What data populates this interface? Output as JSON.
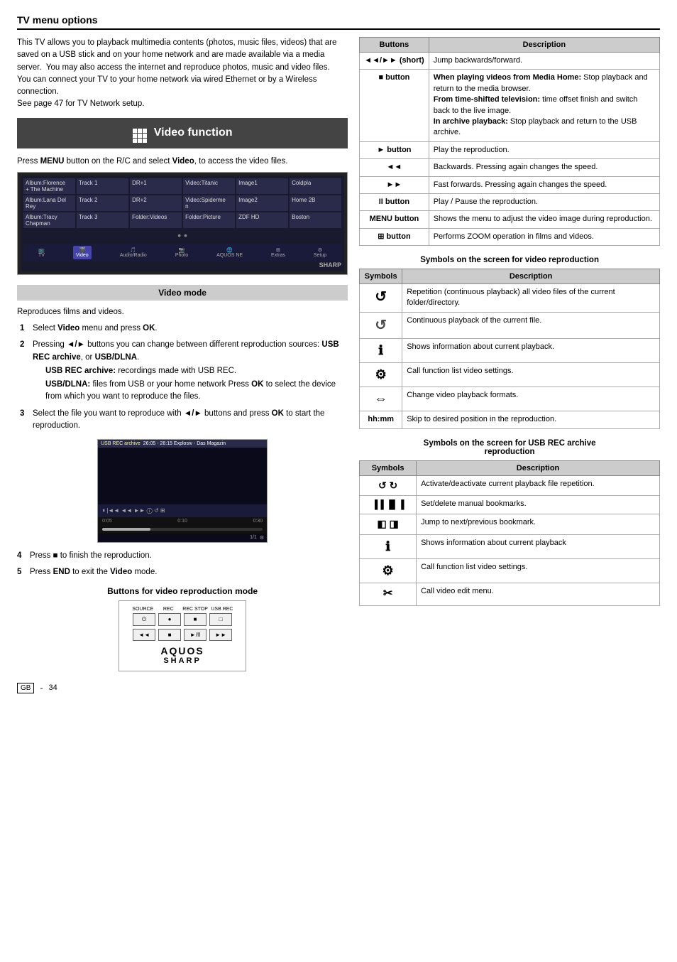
{
  "page": {
    "title": "TV menu options",
    "page_number": "34",
    "gb_label": "GB"
  },
  "intro": {
    "text": "This TV allows you to playback multimedia contents (photos, music files, videos) that are saved on a USB stick and on your home network and are made available via a media server.  You may also access the internet and reproduce photos, music and video files.\nYou can connect your TV to your home network via wired Ethernet or by a Wireless connection.\nSee page 47 for TV Network setup."
  },
  "video_function": {
    "header": "Video function",
    "press_text": "Press MENU button on the R/C and select Video, to access the video files."
  },
  "screenshot_rows": [
    [
      "Album:Florence + The Machine",
      "Track 1",
      "DR+1",
      "Video:Titanic",
      "Image1",
      "Coldpla"
    ],
    [
      "Album:Lana Del Rey",
      "Track 2",
      "DR+2",
      "Video:Spiderme",
      "Image2",
      "Home 2B"
    ],
    [
      "Album:Tracy Chapman",
      "Track 3",
      "Folder:Videos",
      "Folder:Picture",
      "ZDF HD",
      "Boston"
    ]
  ],
  "screenshot_nav": [
    {
      "label": "TV",
      "active": false
    },
    {
      "label": "Video",
      "active": true
    },
    {
      "label": "Audio/Radio",
      "active": false
    },
    {
      "label": "Photo",
      "active": false
    },
    {
      "label": "AQUOS NE",
      "active": false
    },
    {
      "label": "Extras",
      "active": false
    },
    {
      "label": "Setup",
      "active": false
    }
  ],
  "video_mode": {
    "header": "Video mode",
    "text": "Reproduces films and videos.",
    "steps": [
      {
        "num": "1",
        "text": "Select Video menu and press OK."
      },
      {
        "num": "2",
        "text": "Pressing ◄/► buttons you can change between different reproduction sources: USB REC archive, or USB/DLNA.",
        "subtext_1_label": "USB REC archive:",
        "subtext_1": " recordings made with USB REC.",
        "subtext_2_label": "USB/DLNA:",
        "subtext_2": " files from USB or your home network Press OK to select the device from which you want to reproduce the files."
      },
      {
        "num": "3",
        "text": "Select the file you want to reproduce with ◄/► buttons and press OK to start the reproduction."
      }
    ]
  },
  "playback_screenshot": {
    "top_bar": "USB REC archive",
    "time_bar": "26:05 - 26:15  Explosiv - Das Magazin",
    "time_start": "0:05",
    "time_mid": "0:10",
    "time_end": "0:30"
  },
  "step4": "Press   to finish the reproduction.",
  "step5": "Press END to exit the Video mode.",
  "buttons_section": {
    "title": "Buttons for video reproduction mode",
    "remote_rows": [
      [
        {
          "label": "SOURCE\n⏻",
          "sub": "SOURCE"
        },
        {
          "label": "REC\n●",
          "sub": "REC"
        },
        {
          "label": "REC STOP\n■",
          "sub": "REC STOP"
        },
        {
          "label": "USB REC\n□",
          "sub": "USB REC"
        }
      ],
      [
        {
          "label": "◄◄",
          "sub": ""
        },
        {
          "label": "■",
          "sub": ""
        },
        {
          "label": "►/II",
          "sub": ""
        },
        {
          "label": "►►",
          "sub": ""
        }
      ]
    ],
    "aquos": "AQUOS",
    "sharp": "SHARP"
  },
  "right_table": {
    "headers": [
      "Buttons",
      "Description"
    ],
    "rows": [
      {
        "button": "◄◄/►► (short)",
        "description": "Jump backwards/forward."
      },
      {
        "button": "■ button",
        "description": "When playing videos from Media Home: Stop playback and return to the media browser.\nFrom time-shifted television: time offset finish and switch back to the live image.\nIn archive playback: Stop playback and return to the USB archive."
      },
      {
        "button": "► button",
        "description": "Play the reproduction."
      },
      {
        "button": "◄◄",
        "description": "Backwards. Pressing again changes the speed."
      },
      {
        "button": "►►",
        "description": "Fast forwards. Pressing again changes the speed."
      },
      {
        "button": "II button",
        "description": "Play / Pause the reproduction."
      },
      {
        "button": "MENU button",
        "description": "Shows the menu to adjust the video image during reproduction."
      },
      {
        "button": "⊞ button",
        "description": "Performs ZOOM operation in films and videos."
      }
    ]
  },
  "symbols_video": {
    "title": "Symbols on the screen for video reproduction",
    "headers": [
      "Symbols",
      "Description"
    ],
    "rows": [
      {
        "symbol": "↺",
        "description": "Repetition (continuous playback) all video files of the current folder/directory."
      },
      {
        "symbol": "↺",
        "description": "Continuous playback of the current file."
      },
      {
        "symbol": "ℹ",
        "description": "Shows information about current playback."
      },
      {
        "symbol": "⚙",
        "description": "Call function list video settings."
      },
      {
        "symbol": "⇔",
        "description": "Change video playback formats."
      },
      {
        "symbol": "hh:mm",
        "description": "Skip to desired position in the reproduction."
      }
    ]
  },
  "symbols_usb": {
    "title": "Symbols on the screen for USB REC archive reproduction",
    "headers": [
      "Symbols",
      "Description"
    ],
    "rows": [
      {
        "symbol": "↺ ↻",
        "description": "Activate/deactivate current playback file repetition."
      },
      {
        "symbol": "▐▐ ▐▌▐",
        "description": "Set/delete manual bookmarks."
      },
      {
        "symbol": "◧ ◨",
        "description": "Jump to next/previous bookmark."
      },
      {
        "symbol": "ℹ",
        "description": "Shows information about current playback"
      },
      {
        "symbol": "⚙",
        "description": "Call function list video settings."
      },
      {
        "symbol": "✂",
        "description": "Call video edit menu."
      }
    ]
  }
}
